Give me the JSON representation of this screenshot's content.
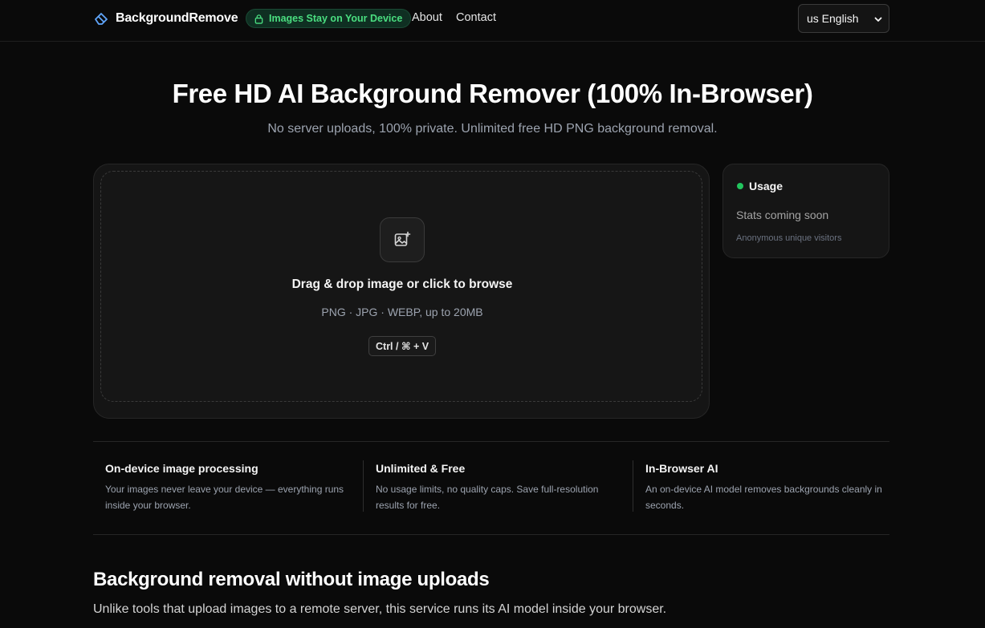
{
  "header": {
    "brand": "BackgroundRemove",
    "privacy_pill": "Images Stay on Your Device",
    "nav": [
      "About",
      "Contact"
    ],
    "language": {
      "selected": "us English"
    }
  },
  "hero": {
    "title": "Free HD AI Background Remover (100% In-Browser)",
    "subtitle": "No server uploads, 100% private. Unlimited free HD PNG background removal."
  },
  "upload": {
    "title": "Drag & drop image or click to browse",
    "formats": "PNG · JPG · WEBP, up to 20MB",
    "shortcut": "Ctrl / ⌘ + V",
    "icon": "image-plus-icon"
  },
  "usage": {
    "title": "Usage",
    "stat": "Stats coming soon",
    "note": "Anonymous unique visitors"
  },
  "features": [
    {
      "title": "On-device image processing",
      "desc": "Your images never leave your device — everything runs inside your browser."
    },
    {
      "title": "Unlimited & Free",
      "desc": "No usage limits, no quality caps. Save full-resolution results for free."
    },
    {
      "title": "In-Browser AI",
      "desc": "An on-device AI model removes backgrounds cleanly in seconds."
    }
  ],
  "section": {
    "title": "Background removal without image uploads",
    "text": "Unlike tools that upload images to a remote server, this service runs its AI model inside your browser."
  },
  "colors": {
    "background": "#0a0a0a",
    "accent_green": "#4ade80",
    "status_dot": "#22c55e"
  }
}
